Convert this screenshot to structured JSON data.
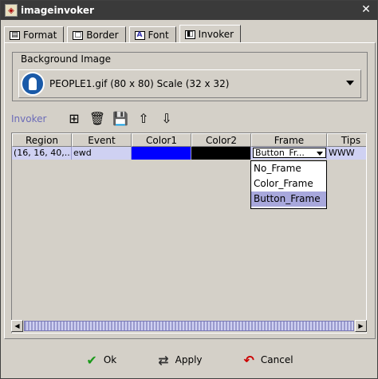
{
  "window": {
    "title": "imageinvoker",
    "close_glyph": "✕"
  },
  "tabs": [
    {
      "label": "Format",
      "icon": "format-icon",
      "active": false
    },
    {
      "label": "Border",
      "icon": "border-icon",
      "active": false
    },
    {
      "label": "Font",
      "icon": "font-icon",
      "active": false
    },
    {
      "label": "Invoker",
      "icon": "invoker-icon",
      "active": true
    }
  ],
  "background_image": {
    "legend": "Background Image",
    "selected": "PEOPLE1.gif  (80 x 80)  Scale (32 x 32)"
  },
  "invoker": {
    "label": "Invoker",
    "toolbar": [
      {
        "name": "add-icon",
        "glyph": "⊞"
      },
      {
        "name": "delete-icon",
        "glyph": "🗑"
      },
      {
        "name": "save-icon",
        "glyph": "💾"
      },
      {
        "name": "arrow-up-icon",
        "glyph": "⇧"
      },
      {
        "name": "arrow-down-icon",
        "glyph": "⇩"
      }
    ]
  },
  "table": {
    "columns": [
      "Region",
      "Event",
      "Color1",
      "Color2",
      "Frame",
      "Tips"
    ],
    "rows": [
      {
        "region": "(16, 16, 40,...",
        "event": "ewd",
        "color1": "#0000ff",
        "color2": "#000000",
        "frame": "Button_Fr...",
        "tips": "WWW"
      }
    ]
  },
  "frame_options": [
    "No_Frame",
    "Color_Frame",
    "Button_Frame"
  ],
  "frame_selected_index": 2,
  "footer": {
    "ok": "Ok",
    "apply": "Apply",
    "cancel": "Cancel"
  },
  "colors": {
    "accent": "#6b6bb8",
    "selection": "#a8a8dc",
    "row_bg": "#cfd1f2"
  }
}
